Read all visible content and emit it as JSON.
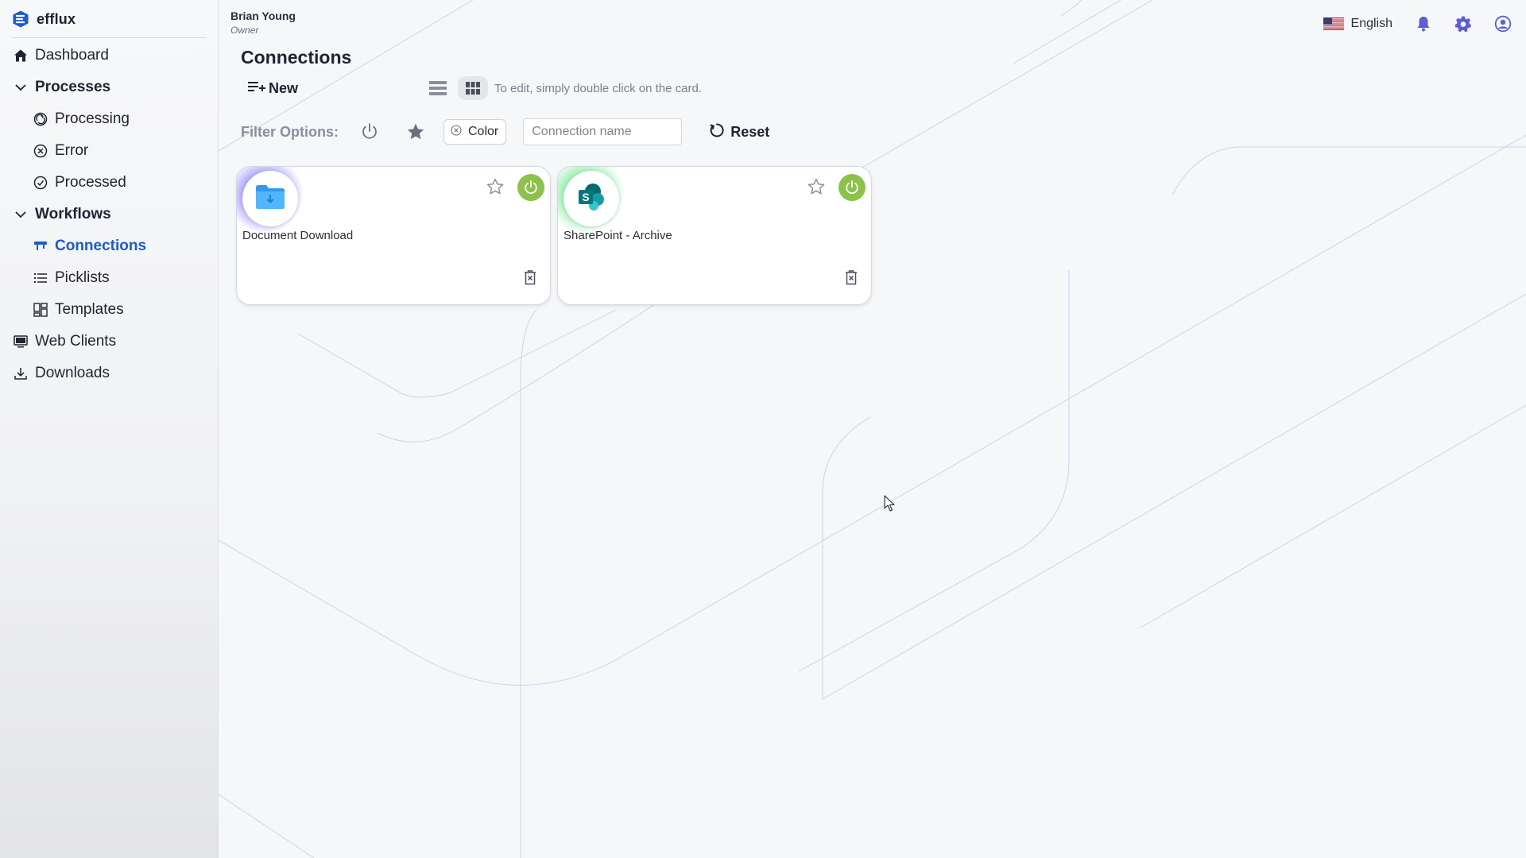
{
  "app": {
    "brand_name": "efflux",
    "accent_color": "#1a5ccf",
    "power_on_color": "#8bc34a"
  },
  "user": {
    "name": "Brian Young",
    "role": "Owner"
  },
  "sidebar": {
    "items": [
      {
        "label": "Dashboard",
        "icon": "home-icon"
      },
      {
        "label": "Processes",
        "icon": "chevron-down-icon",
        "expanded": true
      },
      {
        "label": "Processing",
        "icon": "processing-icon"
      },
      {
        "label": "Error",
        "icon": "error-circle-icon"
      },
      {
        "label": "Processed",
        "icon": "check-circle-icon"
      },
      {
        "label": "Workflows",
        "icon": "chevron-down-icon",
        "expanded": true
      },
      {
        "label": "Connections",
        "icon": "connections-icon",
        "active": true
      },
      {
        "label": "Picklists",
        "icon": "list-icon"
      },
      {
        "label": "Templates",
        "icon": "templates-icon"
      },
      {
        "label": "Web Clients",
        "icon": "monitor-icon"
      },
      {
        "label": "Downloads",
        "icon": "download-icon"
      }
    ]
  },
  "topbar": {
    "language": "English",
    "language_flag": "us-flag-icon",
    "icons": [
      "bell-icon",
      "gear-icon",
      "user-circle-icon"
    ]
  },
  "page": {
    "title": "Connections",
    "new_label": "New",
    "hint": "To edit, simply double click on the card.",
    "view_mode": "grid"
  },
  "filters": {
    "label": "Filter Options:",
    "color_chip_label": "Color",
    "search_placeholder": "Connection name",
    "search_value": "",
    "reset_label": "Reset"
  },
  "connections": [
    {
      "name": "Document Download",
      "icon": "folder-download-icon",
      "glow_color": "#6a5cff",
      "favorite": false,
      "enabled": true
    },
    {
      "name": "SharePoint - Archive",
      "icon": "sharepoint-icon",
      "glow_color": "#3ee36a",
      "favorite": false,
      "enabled": true
    }
  ]
}
